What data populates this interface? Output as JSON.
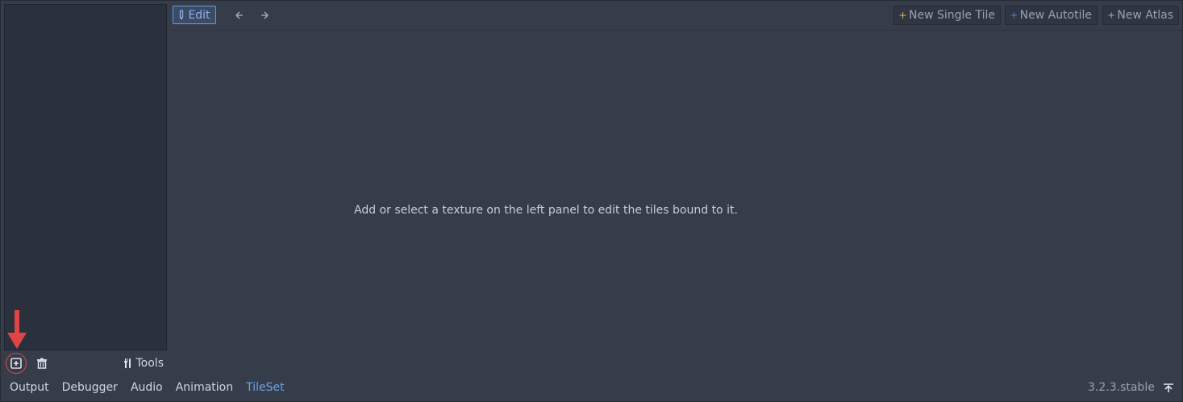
{
  "toolbar": {
    "edit_label": "Edit",
    "new_single_tile": "New Single Tile",
    "new_autotile": "New Autotile",
    "new_atlas": "New Atlas"
  },
  "main": {
    "hint": "Add or select a texture on the left panel to edit the tiles bound to it."
  },
  "left_panel": {
    "tools_label": "Tools"
  },
  "bottom": {
    "tabs": [
      "Output",
      "Debugger",
      "Audio",
      "Animation",
      "TileSet"
    ],
    "active_tab": "TileSet",
    "version": "3.2.3.stable"
  },
  "icons": {
    "add": "add-texture-icon",
    "delete": "trash-icon",
    "tools": "tools-icon",
    "edit": "pencil-icon",
    "back": "arrow-left-icon",
    "forward": "arrow-right-icon",
    "plus": "plus-icon",
    "expand": "expand-panel-icon"
  },
  "colors": {
    "accent": "#6ea3e8",
    "annotation": "#e04545",
    "single_tile_plus": "#c8b24a",
    "autotile_plus": "#4a7fd0",
    "atlas_plus": "#9aa1ae"
  }
}
